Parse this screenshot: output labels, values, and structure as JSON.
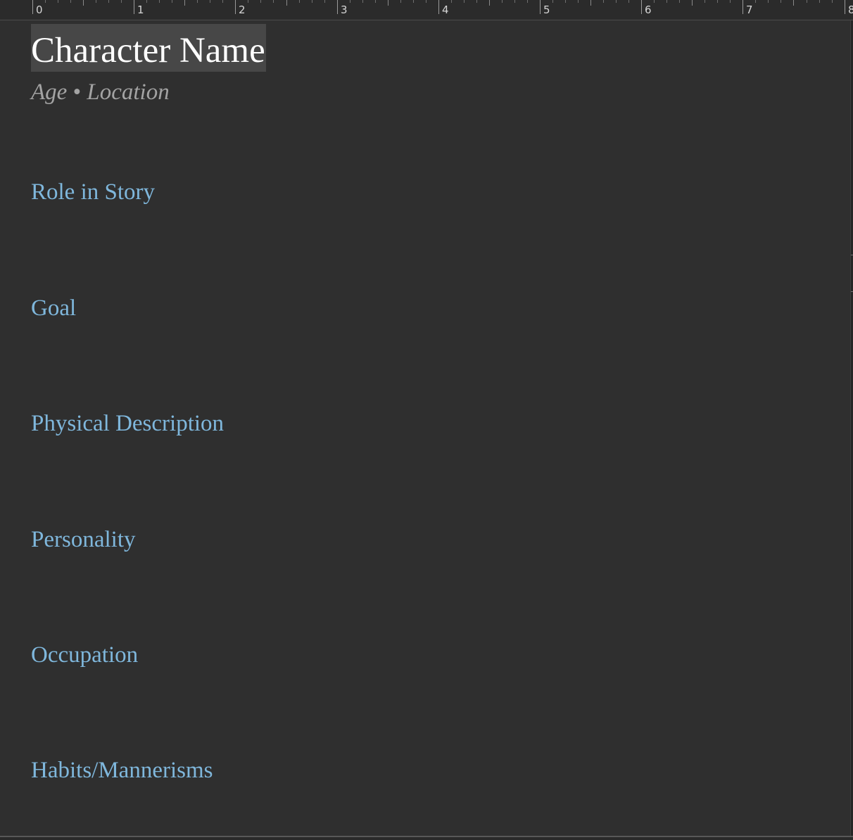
{
  "ruler": {
    "labels": [
      "0",
      "1",
      "2",
      "3",
      "4",
      "5",
      "6",
      "7",
      "8"
    ]
  },
  "document": {
    "title": "Character Name",
    "subtitle": {
      "age": "Age",
      "separator": "•",
      "location": "Location"
    },
    "sections": [
      {
        "label": "Role in Story"
      },
      {
        "label": "Goal"
      },
      {
        "label": "Physical Description"
      },
      {
        "label": "Personality"
      },
      {
        "label": "Occupation"
      },
      {
        "label": "Habits/Mannerisms"
      }
    ]
  },
  "colors": {
    "background": "#2f2f2f",
    "heading": "#7fb7dc",
    "title": "#ffffff",
    "subtitle": "#a3a3a3",
    "title_highlight": "#474747"
  }
}
